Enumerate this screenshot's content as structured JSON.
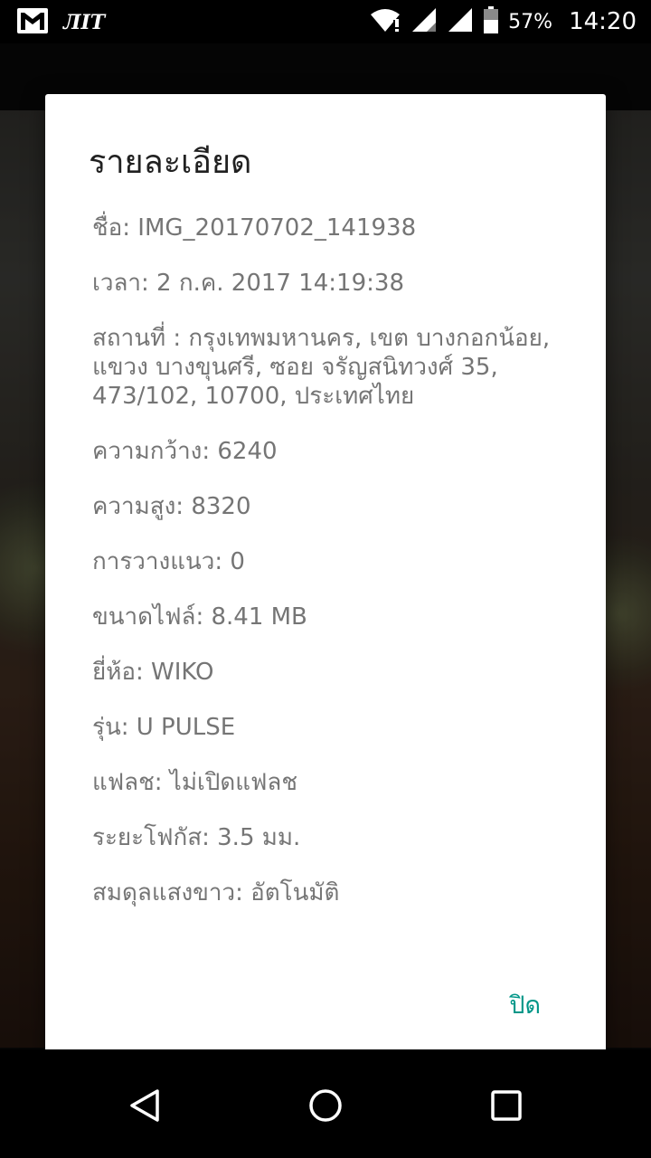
{
  "status_bar": {
    "left_icons": [
      "gmail-icon",
      "app-notification-icon"
    ],
    "app_label": "ЛІТ",
    "battery_percent": "57%",
    "time": "14:20",
    "right_icons": [
      "wifi-icon",
      "signal-icon",
      "signal-icon",
      "battery-icon"
    ]
  },
  "dialog": {
    "title": "รายละเอียด",
    "details": [
      "ชื่อ: IMG_20170702_141938",
      "เวลา: 2 ก.ค. 2017 14:19:38",
      "สถานที่ : กรุงเทพมหานคร, เขต บางกอกน้อย, แขวง บางขุนศรี, ซอย จรัญสนิทวงศ์ 35, 473/102, 10700, ประเทศไทย",
      "ความกว้าง: 6240",
      "ความสูง: 8320",
      "การวางแนว: 0",
      "ขนาดไฟล์: 8.41 MB",
      "ยี่ห้อ: WIKO",
      "รุ่น: U PULSE",
      "แฟลช: ไม่เปิดแฟลช",
      "ระยะโฟกัส: 3.5 มม.",
      "สมดุลแสงขาว: อัตโนมัติ"
    ],
    "close_label": "ปิด"
  },
  "nav_bar": {
    "icons": [
      "back-icon",
      "home-icon",
      "recents-icon"
    ]
  },
  "colors": {
    "accent": "#009688",
    "dialog_bg": "#ffffff",
    "title_text": "#212121",
    "body_text": "#757575"
  }
}
